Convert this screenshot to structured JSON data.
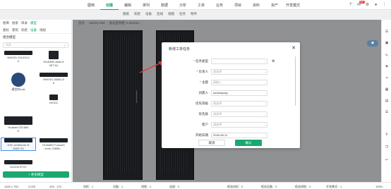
{
  "menu": [
    "图档",
    "创建",
    "编辑",
    "排列",
    "数据",
    "分析",
    "工单",
    "业务",
    "项目",
    "资料",
    "资产",
    "开发模式"
  ],
  "menu_active_index": 1,
  "badge": "99+",
  "toolbar": [
    "图纸",
    "机柜",
    "设备",
    "连线",
    "视图",
    "任务",
    "附件"
  ],
  "left": {
    "tabs1": [
      "图库",
      "搜索",
      "目录",
      "模型"
    ],
    "tabs2": [
      "图标",
      "建筑",
      "机柜",
      "设备",
      "线缆"
    ],
    "section": "组合模型",
    "search_placeholder": "搜索",
    "items": [
      {
        "label": "NWVDI-1SU2412\nU",
        "shape": "flat"
      },
      {
        "label": "HUAWEI Atlas 8\n00T A2",
        "shape": "box"
      },
      {
        "label": "通信的hole",
        "shape": "round"
      },
      {
        "label": "NWVDI-18862-8\nK",
        "shape": "flat"
      },
      {
        "label": "",
        "shape": "blank"
      },
      {
        "label": "DK511",
        "shape": "small"
      },
      {
        "label": "Huawei CE1680\nK",
        "shape": "tall"
      },
      {
        "label": "",
        "shape": "blank"
      },
      {
        "label": "H3C UniServer R\n4900 G3",
        "shape": "flat",
        "selected": true
      },
      {
        "label": "HUAWEI FusionS\nerver 2288H...",
        "shape": "flat"
      },
      {
        "label": "KunTai R722",
        "shape": "flat"
      }
    ],
    "add_button": "+ 更多模型"
  },
  "breadcrumb": [
    "首页",
    "rack01-000",
    "会员室机柜-A-003/20..."
  ],
  "modal": {
    "title": "新增工单任务",
    "fields": [
      {
        "label": "任务类型",
        "required": true,
        "value": "",
        "placeholder": "",
        "kind": "select"
      },
      {
        "label": "负责人",
        "required": true,
        "value": "",
        "placeholder": "请选择",
        "kind": "select"
      },
      {
        "label": "主题",
        "required": true,
        "value": "",
        "placeholder": "请输入",
        "kind": "input"
      },
      {
        "label": "创建人",
        "required": false,
        "value": "sunlanyong",
        "placeholder": "",
        "kind": "input"
      },
      {
        "label": "优先等级",
        "required": false,
        "value": "",
        "placeholder": "请选择",
        "kind": "select"
      },
      {
        "label": "优先级",
        "required": false,
        "value": "",
        "placeholder": "请选择",
        "kind": "select"
      },
      {
        "label": "客户",
        "required": false,
        "value": "",
        "placeholder": "请选择",
        "kind": "select"
      },
      {
        "label": "开始日期",
        "required": false,
        "value": "2025-06-11",
        "placeholder": "",
        "kind": "input"
      }
    ],
    "cancel": "取消",
    "confirm": "确认"
  },
  "status": {
    "size": "1000 x 750",
    "coords": "3.025",
    "pos": "426 , 176",
    "rack": "机柜：1",
    "device": "设备：1",
    "cable": "线缆：0",
    "conn": "连接：0",
    "sel_rack": "框选机柜：0",
    "sel_device": "框选设备：0",
    "sel_cable": "框选线缆：0",
    "dev_mode": "开发模式：1",
    "zoom": "100%"
  },
  "colors": {
    "accent": "#16a06a",
    "confirm": "#1aa86e",
    "arrow": "#e33b3b"
  }
}
